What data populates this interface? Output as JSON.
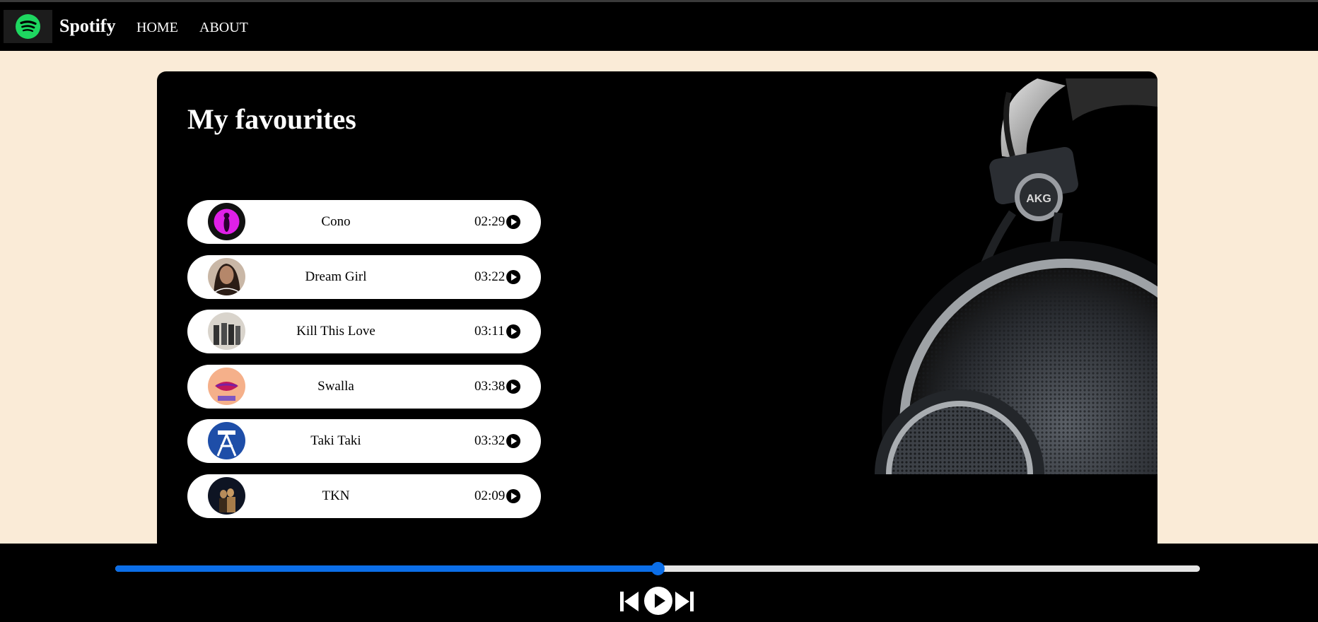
{
  "navbar": {
    "brand": "Spotify",
    "logo_icon": "spotify-logo-icon",
    "links": [
      {
        "label": "HOME"
      },
      {
        "label": "ABOUT"
      }
    ]
  },
  "main": {
    "title": "My favourites",
    "hero_image": "headphones-image",
    "songs": [
      {
        "title": "Cono",
        "duration": "02:29",
        "thumb": "cono-cover"
      },
      {
        "title": "Dream Girl",
        "duration": "03:22",
        "thumb": "dream-girl-cover"
      },
      {
        "title": "Kill This Love",
        "duration": "03:11",
        "thumb": "kill-this-love-cover"
      },
      {
        "title": "Swalla",
        "duration": "03:38",
        "thumb": "swalla-cover"
      },
      {
        "title": "Taki Taki",
        "duration": "03:32",
        "thumb": "taki-taki-cover"
      },
      {
        "title": "TKN",
        "duration": "02:09",
        "thumb": "tkn-cover"
      }
    ]
  },
  "player": {
    "progress_fraction": 0.5,
    "controls": [
      "skip-previous-icon",
      "play-icon",
      "skip-next-icon"
    ]
  },
  "colors": {
    "page_bg": "#faebd7",
    "nav_bg": "#000000",
    "brand_green": "#1ed760",
    "progress_accent": "#0b6ee8",
    "track": "#e5e5e5"
  }
}
